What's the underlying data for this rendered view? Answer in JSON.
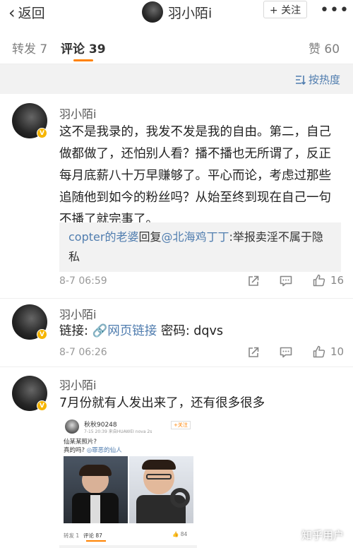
{
  "header": {
    "back_label": "返回",
    "title": "羽小陌i",
    "follow_label": "+ 关注",
    "more_label": "•••"
  },
  "tabs": {
    "repost": "转发 7",
    "comments": "评论 39",
    "likes": "赞 60"
  },
  "sort": {
    "label": "按热度"
  },
  "comments": [
    {
      "name": "羽小陌i",
      "text": "这不是我录的，我发不发是我的自由。第二，自己做都做了，还怕别人看？播不播也无所谓了，反正每月底薪八十万早赚够了。平心而论，考虑过那些追随他到如今的粉丝吗？从始至终到现在自己一句不播了就完事了。",
      "reply": {
        "user": "copter的老婆",
        "mid": "回复",
        "mention": "@北海鸡丁丁",
        "text": ":举报卖淫不属于隐私"
      },
      "time": "8-7 06:59",
      "likes": "16"
    },
    {
      "name": "羽小陌i",
      "text_prefix": "链接: ",
      "link_label": "网页链接",
      "text_suffix": " 密码: dqvs",
      "time": "8-7 06:26",
      "likes": "10"
    },
    {
      "name": "羽小陌i",
      "text": "7月份就有人发出来了，还有很多很多"
    }
  ],
  "embedded_post": {
    "name": "秋秋90248",
    "meta": "7-15 20:39  来自HUAWEI nova 2s",
    "follow": "+关注",
    "text_line1": "仙某某照片?",
    "text_line2": "真的吗? ",
    "link": "◎罪恶的仙人",
    "repost": "转发 1",
    "comments": "评论 87",
    "likes": "84"
  },
  "watermark": "知乎用户",
  "colors": {
    "link": "#507daf",
    "accent": "#ff8200",
    "badge": "#f6b500"
  }
}
